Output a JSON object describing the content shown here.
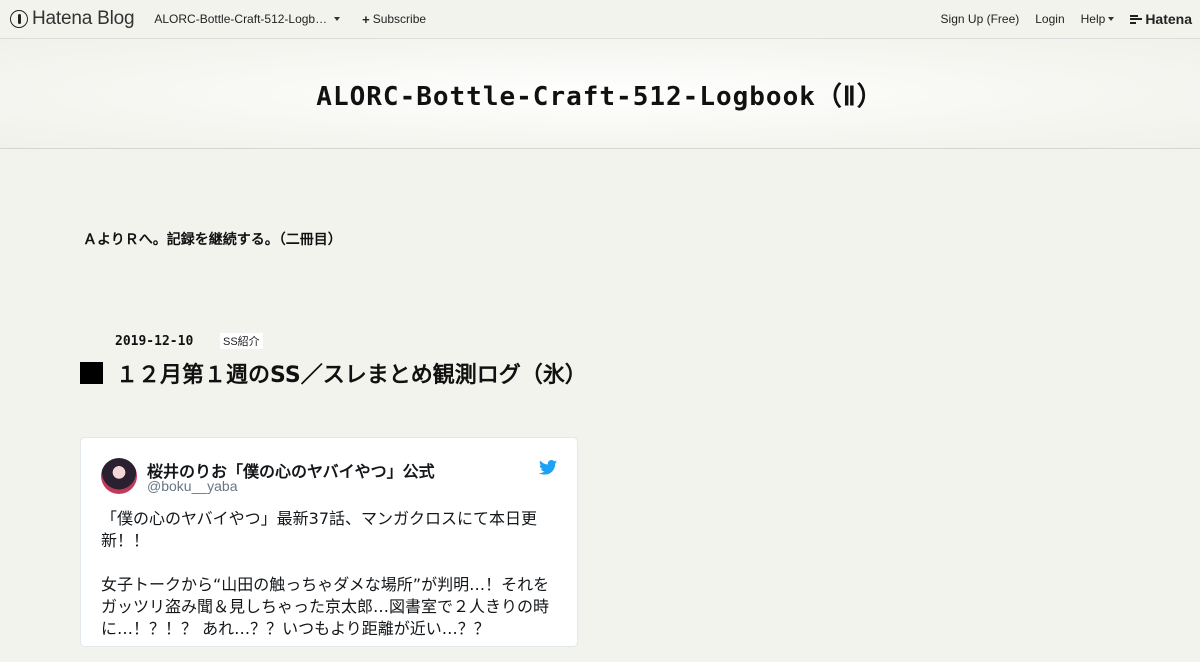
{
  "topbar": {
    "logo_text": "Hatena Blog",
    "blog_name": "ALORC-Bottle-Craft-512-Logb…",
    "subscribe_label": "Subscribe",
    "signup_label": "Sign Up (Free)",
    "login_label": "Login",
    "help_label": "Help",
    "brand_label": "Hatena"
  },
  "header": {
    "title": "ALORC-Bottle-Craft-512-Logbook（Ⅱ）"
  },
  "blog": {
    "description": "ＡよりＲへ。記録を継続する。（二冊目）"
  },
  "entry": {
    "date": "2019-12-10",
    "category": "SS紹介",
    "title": "１２月第１週のSS／スレまとめ観測ログ（氷）"
  },
  "tweet": {
    "author_name": "桜井のりお「僕の心のヤバイやつ」公式",
    "author_handle": "@boku__yaba",
    "paragraph1": "「僕の心のヤバイやつ」最新37話、マンガクロスにて本日更新！！",
    "paragraph2": "女子トークから“山田の触っちゃダメな場所”が判明…！それをガッツリ盗み聞＆見しちゃった京太郎…図書室で２人きりの時に…！？！？ あれ…？？いつもより距離が近い…？？"
  },
  "icons": {
    "logo": "hatena-pen-icon",
    "dropdown": "caret-down-icon",
    "subscribe": "plus-icon",
    "brand": "hatena-lines-icon",
    "tweet": "twitter-bird-icon"
  },
  "colors": {
    "background": "#f3f3ee",
    "twitter_blue": "#1da1f2",
    "text": "#111111"
  }
}
